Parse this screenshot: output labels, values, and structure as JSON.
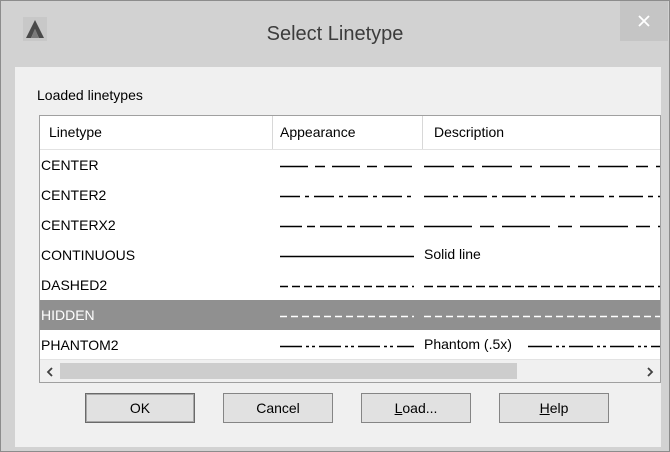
{
  "window": {
    "title": "Select Linetype"
  },
  "group_label": "Loaded linetypes",
  "columns": {
    "linetype": "Linetype",
    "appearance": "Appearance",
    "description": "Description"
  },
  "rows": [
    {
      "name": "CENTER",
      "desc_text": "",
      "pattern": "center",
      "selected": false
    },
    {
      "name": "CENTER2",
      "desc_text": "",
      "pattern": "center2",
      "selected": false
    },
    {
      "name": "CENTERX2",
      "desc_text": "",
      "pattern": "centerx2",
      "selected": false
    },
    {
      "name": "CONTINUOUS",
      "desc_text": "Solid line",
      "pattern": "continuous",
      "selected": false
    },
    {
      "name": "DASHED2",
      "desc_text": "",
      "pattern": "dashed2",
      "selected": false
    },
    {
      "name": "HIDDEN",
      "desc_text": "",
      "pattern": "hidden",
      "selected": true
    },
    {
      "name": "PHANTOM2",
      "desc_text": "Phantom (.5x)",
      "pattern": "phantom2",
      "selected": false
    }
  ],
  "buttons": {
    "ok": "OK",
    "cancel": "Cancel",
    "load": {
      "mnemonic": "L",
      "rest": "oad..."
    },
    "help": {
      "mnemonic": "H",
      "rest": "elp"
    }
  },
  "colors": {
    "selection": "#909090",
    "dialog_bg": "#f0f0f0",
    "frame": "#d2d2d2"
  }
}
